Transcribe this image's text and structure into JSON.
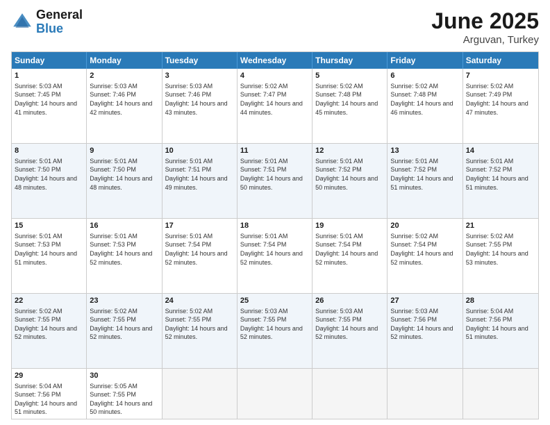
{
  "logo": {
    "general": "General",
    "blue": "Blue"
  },
  "title": "June 2025",
  "location": "Arguvan, Turkey",
  "days": [
    "Sunday",
    "Monday",
    "Tuesday",
    "Wednesday",
    "Thursday",
    "Friday",
    "Saturday"
  ],
  "weeks": [
    [
      {
        "day": 1,
        "sunrise": "5:03 AM",
        "sunset": "7:45 PM",
        "daylight": "14 hours and 41 minutes."
      },
      {
        "day": 2,
        "sunrise": "5:03 AM",
        "sunset": "7:46 PM",
        "daylight": "14 hours and 42 minutes."
      },
      {
        "day": 3,
        "sunrise": "5:03 AM",
        "sunset": "7:46 PM",
        "daylight": "14 hours and 43 minutes."
      },
      {
        "day": 4,
        "sunrise": "5:02 AM",
        "sunset": "7:47 PM",
        "daylight": "14 hours and 44 minutes."
      },
      {
        "day": 5,
        "sunrise": "5:02 AM",
        "sunset": "7:48 PM",
        "daylight": "14 hours and 45 minutes."
      },
      {
        "day": 6,
        "sunrise": "5:02 AM",
        "sunset": "7:48 PM",
        "daylight": "14 hours and 46 minutes."
      },
      {
        "day": 7,
        "sunrise": "5:02 AM",
        "sunset": "7:49 PM",
        "daylight": "14 hours and 47 minutes."
      }
    ],
    [
      {
        "day": 8,
        "sunrise": "5:01 AM",
        "sunset": "7:50 PM",
        "daylight": "14 hours and 48 minutes."
      },
      {
        "day": 9,
        "sunrise": "5:01 AM",
        "sunset": "7:50 PM",
        "daylight": "14 hours and 48 minutes."
      },
      {
        "day": 10,
        "sunrise": "5:01 AM",
        "sunset": "7:51 PM",
        "daylight": "14 hours and 49 minutes."
      },
      {
        "day": 11,
        "sunrise": "5:01 AM",
        "sunset": "7:51 PM",
        "daylight": "14 hours and 50 minutes."
      },
      {
        "day": 12,
        "sunrise": "5:01 AM",
        "sunset": "7:52 PM",
        "daylight": "14 hours and 50 minutes."
      },
      {
        "day": 13,
        "sunrise": "5:01 AM",
        "sunset": "7:52 PM",
        "daylight": "14 hours and 51 minutes."
      },
      {
        "day": 14,
        "sunrise": "5:01 AM",
        "sunset": "7:52 PM",
        "daylight": "14 hours and 51 minutes."
      }
    ],
    [
      {
        "day": 15,
        "sunrise": "5:01 AM",
        "sunset": "7:53 PM",
        "daylight": "14 hours and 51 minutes."
      },
      {
        "day": 16,
        "sunrise": "5:01 AM",
        "sunset": "7:53 PM",
        "daylight": "14 hours and 52 minutes."
      },
      {
        "day": 17,
        "sunrise": "5:01 AM",
        "sunset": "7:54 PM",
        "daylight": "14 hours and 52 minutes."
      },
      {
        "day": 18,
        "sunrise": "5:01 AM",
        "sunset": "7:54 PM",
        "daylight": "14 hours and 52 minutes."
      },
      {
        "day": 19,
        "sunrise": "5:01 AM",
        "sunset": "7:54 PM",
        "daylight": "14 hours and 52 minutes."
      },
      {
        "day": 20,
        "sunrise": "5:02 AM",
        "sunset": "7:54 PM",
        "daylight": "14 hours and 52 minutes."
      },
      {
        "day": 21,
        "sunrise": "5:02 AM",
        "sunset": "7:55 PM",
        "daylight": "14 hours and 53 minutes."
      }
    ],
    [
      {
        "day": 22,
        "sunrise": "5:02 AM",
        "sunset": "7:55 PM",
        "daylight": "14 hours and 52 minutes."
      },
      {
        "day": 23,
        "sunrise": "5:02 AM",
        "sunset": "7:55 PM",
        "daylight": "14 hours and 52 minutes."
      },
      {
        "day": 24,
        "sunrise": "5:02 AM",
        "sunset": "7:55 PM",
        "daylight": "14 hours and 52 minutes."
      },
      {
        "day": 25,
        "sunrise": "5:03 AM",
        "sunset": "7:55 PM",
        "daylight": "14 hours and 52 minutes."
      },
      {
        "day": 26,
        "sunrise": "5:03 AM",
        "sunset": "7:55 PM",
        "daylight": "14 hours and 52 minutes."
      },
      {
        "day": 27,
        "sunrise": "5:03 AM",
        "sunset": "7:56 PM",
        "daylight": "14 hours and 52 minutes."
      },
      {
        "day": 28,
        "sunrise": "5:04 AM",
        "sunset": "7:56 PM",
        "daylight": "14 hours and 51 minutes."
      }
    ],
    [
      {
        "day": 29,
        "sunrise": "5:04 AM",
        "sunset": "7:56 PM",
        "daylight": "14 hours and 51 minutes."
      },
      {
        "day": 30,
        "sunrise": "5:05 AM",
        "sunset": "7:55 PM",
        "daylight": "14 hours and 50 minutes."
      },
      null,
      null,
      null,
      null,
      null
    ]
  ]
}
